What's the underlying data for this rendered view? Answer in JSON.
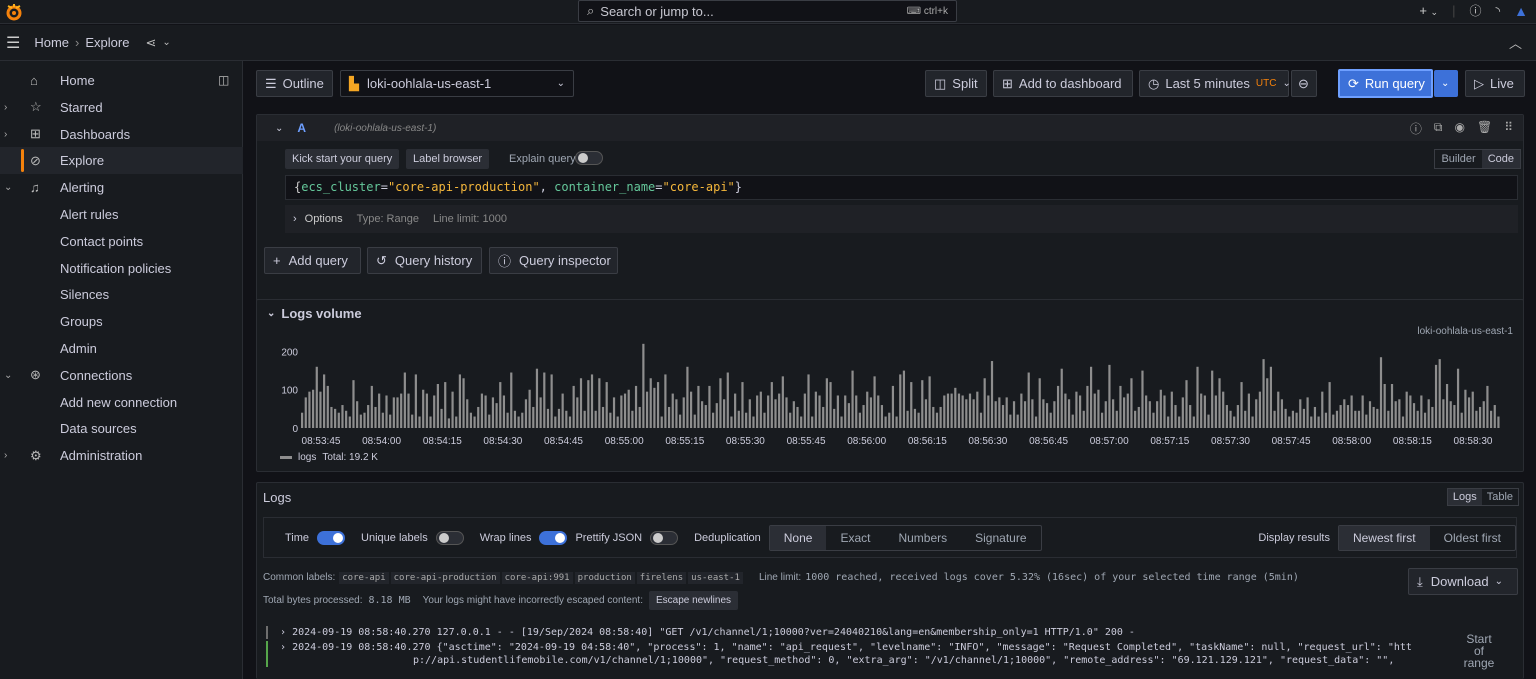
{
  "topbar": {
    "search_placeholder": "Search or jump to...",
    "search_shortcut": "ctrl+k",
    "add_label": "+"
  },
  "breadcrumb": {
    "home": "Home",
    "sep": "›",
    "current": "Explore"
  },
  "sidebar": {
    "items": [
      {
        "label": "Home",
        "icon": "home-icon",
        "caret": ""
      },
      {
        "label": "Starred",
        "icon": "star-icon",
        "caret": "›"
      },
      {
        "label": "Dashboards",
        "icon": "dashboards-icon",
        "caret": "›"
      },
      {
        "label": "Explore",
        "icon": "compass-icon",
        "caret": "",
        "active": true
      },
      {
        "label": "Alerting",
        "icon": "bell-icon",
        "caret": "⌄"
      },
      {
        "label": "Alert rules"
      },
      {
        "label": "Contact points"
      },
      {
        "label": "Notification policies"
      },
      {
        "label": "Silences"
      },
      {
        "label": "Groups"
      },
      {
        "label": "Admin"
      },
      {
        "label": "Connections",
        "icon": "connections-icon",
        "caret": "⌄"
      },
      {
        "label": "Add new connection"
      },
      {
        "label": "Data sources"
      },
      {
        "label": "Administration",
        "icon": "gear-icon",
        "caret": "›"
      }
    ]
  },
  "toolbar": {
    "outline": "Outline",
    "datasource": "loki-oohlala-us-east-1",
    "split": "Split",
    "add_to_dashboard": "Add to dashboard",
    "time_range": "Last 5 minutes",
    "timezone": "UTC",
    "run_query": "Run query",
    "live": "Live"
  },
  "query": {
    "ref": "A",
    "datasource_hint": "(loki-oohlala-us-east-1)",
    "kick_start": "Kick start your query",
    "label_browser": "Label browser",
    "explain_query": "Explain query",
    "mode_builder": "Builder",
    "mode_code": "Code",
    "expr_open": "{",
    "k1": "ecs_cluster",
    "v1": "\"core-api-production\"",
    "sep": ", ",
    "k2": "container_name",
    "v2": "\"core-api\"",
    "expr_close": "}",
    "options": "Options",
    "type": "Type: Range",
    "line_limit": "Line limit: 1000",
    "add_query": "Add query",
    "query_history": "Query history",
    "query_inspector": "Query inspector"
  },
  "logs_volume": {
    "title": "Logs volume",
    "series_label": "loki-oohlala-us-east-1",
    "legend": "logs",
    "total": "Total: 19.2 K"
  },
  "chart_data": {
    "type": "bar",
    "yticks": [
      "200",
      "100",
      "0"
    ],
    "ylim": [
      0,
      230
    ],
    "xticks": [
      "08:53:45",
      "08:54:00",
      "08:54:15",
      "08:54:30",
      "08:54:45",
      "08:55:00",
      "08:55:15",
      "08:55:30",
      "08:55:45",
      "08:56:00",
      "08:56:15",
      "08:56:30",
      "08:56:45",
      "08:57:00",
      "08:57:15",
      "08:57:30",
      "08:57:45",
      "08:58:00",
      "08:58:15",
      "08:58:30"
    ],
    "series": [
      {
        "name": "logs",
        "values": [
          40,
          80,
          95,
          100,
          160,
          95,
          140,
          110,
          55,
          50,
          40,
          60,
          45,
          30,
          125,
          70,
          35,
          40,
          60,
          110,
          55,
          90,
          40,
          85,
          35,
          80,
          80,
          90,
          145,
          90,
          35,
          140,
          30,
          100,
          90,
          30,
          85,
          115,
          50,
          120,
          25,
          95,
          30,
          140,
          130,
          75,
          40,
          30,
          55,
          90,
          85,
          35,
          80,
          65,
          120,
          85,
          40,
          145,
          45,
          30,
          40,
          75,
          100,
          55,
          155,
          80,
          145,
          50,
          140,
          30,
          50,
          90,
          45,
          30,
          110,
          80,
          130,
          45,
          125,
          140,
          45,
          130,
          55,
          120,
          40,
          80,
          30,
          85,
          90,
          100,
          45,
          110,
          55,
          220,
          95,
          130,
          105,
          120,
          30,
          140,
          55,
          90,
          75,
          35,
          80,
          160,
          95,
          35,
          110,
          70,
          60,
          110,
          40,
          65,
          130,
          75,
          145,
          30,
          90,
          45,
          120,
          40,
          75,
          30,
          85,
          95,
          40,
          85,
          120,
          75,
          90,
          135,
          80,
          40,
          70,
          55,
          30,
          90,
          140,
          30,
          95,
          85,
          55,
          130,
          120,
          50,
          85,
          30,
          85,
          65,
          150,
          85,
          40,
          60,
          95,
          80,
          135,
          85,
          60,
          30,
          40,
          110,
          30,
          140,
          150,
          45,
          120,
          50,
          40,
          125,
          75,
          135,
          55,
          40,
          55,
          85,
          90,
          90,
          105,
          90,
          85,
          75,
          90,
          75,
          95,
          40,
          130,
          85,
          175,
          70,
          80,
          60,
          80,
          35,
          70,
          35,
          90,
          70,
          145,
          75,
          30,
          130,
          75,
          65,
          40,
          70,
          110,
          155,
          90,
          75,
          35,
          95,
          85,
          45,
          110,
          160,
          90,
          100,
          40,
          70,
          165,
          75,
          45,
          110,
          80,
          90,
          130,
          45,
          55,
          150,
          85,
          70,
          40,
          70,
          100,
          85,
          30,
          95,
          60,
          30,
          80,
          125,
          60,
          30,
          160,
          90,
          85,
          35,
          150,
          85,
          130,
          95,
          60,
          45,
          30,
          60,
          120,
          45,
          90,
          30,
          75,
          95,
          180,
          130,
          160,
          45,
          95,
          75,
          50,
          30,
          45,
          40,
          75,
          50,
          80,
          30,
          55,
          30,
          95,
          40,
          120,
          35,
          45,
          60,
          75,
          60,
          85,
          45,
          45,
          85,
          35,
          70,
          55,
          50,
          185,
          115,
          45,
          115,
          70,
          75,
          30,
          95,
          85,
          65,
          45,
          85,
          40,
          75,
          55,
          165,
          180,
          75,
          115,
          70,
          60,
          155,
          40,
          100,
          80,
          95,
          45,
          55,
          70,
          110,
          45,
          60,
          30
        ]
      }
    ]
  },
  "logs": {
    "title": "Logs",
    "view_logs": "Logs",
    "view_table": "Table",
    "time": "Time",
    "unique_labels": "Unique labels",
    "wrap_lines": "Wrap lines",
    "prettify_json": "Prettify JSON",
    "deduplication": "Deduplication",
    "dedup_options": [
      "None",
      "Exact",
      "Numbers",
      "Signature"
    ],
    "display_results": "Display results",
    "newest_first": "Newest first",
    "oldest_first": "Oldest first",
    "common_labels_title": "Common labels:",
    "common_labels": [
      "core-api",
      "core-api-production",
      "core-api:991",
      "production",
      "firelens",
      "us-east-1"
    ],
    "line_limit_label": "Line limit:",
    "line_limit_text": "1000 reached, received logs cover 5.32% (16sec) of your selected time range (5min)",
    "download": "Download",
    "bytes_label": "Total bytes processed:",
    "bytes_value": "8.18 MB",
    "escaped_warning": "Your logs might have incorrectly escaped content:",
    "escape_newlines": "Escape newlines",
    "start_of_range": "Start of range",
    "rows": [
      {
        "ts": "2024-09-19 08:58:40.270",
        "line": "127.0.0.1 - - [19/Sep/2024 08:58:40] \"GET /v1/channel/1;10000?ver=24040210&lang=en&membership_only=1 HTTP/1.0\" 200 -",
        "color": "#6e6e6e"
      },
      {
        "ts": "2024-09-19 08:58:40.270",
        "line": "{\"asctime\": \"2024-09-19 04:58:40\", \"process\": 1, \"name\": \"api_request\", \"levelname\": \"INFO\", \"message\": \"Request Completed\", \"taskName\": null, \"request_url\": \"htt",
        "line2": "p://api.studentlifemobile.com/v1/channel/1;10000\", \"request_method\": 0, \"extra_arg\": \"/v1/channel/1;10000\", \"remote_address\": \"69.121.129.121\", \"request_data\": \"\",",
        "color": "#56a64b"
      }
    ]
  }
}
